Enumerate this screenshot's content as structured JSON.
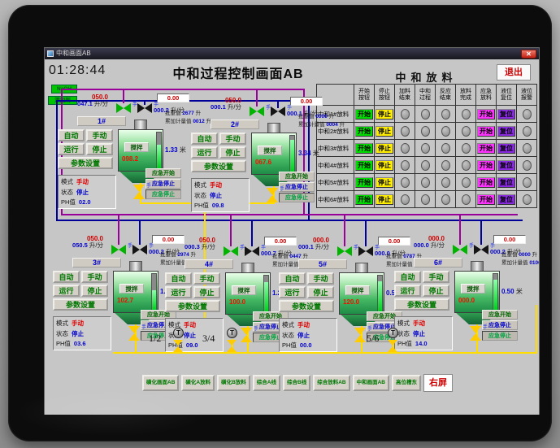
{
  "window": {
    "title": "中和画面AB",
    "close": "✕"
  },
  "header": {
    "time": "01:28:44",
    "title": "中和过程控制画面AB",
    "discharge_title": "中和放料",
    "exit_label": "退出"
  },
  "sources": {
    "line1": "NaOH",
    "line2": "添加剂"
  },
  "reactor_common": {
    "auto": "自动",
    "manual": "手动",
    "run": "运行",
    "stop": "停止",
    "params": "参数设置",
    "mode_label": "模式",
    "state_label": "状态",
    "ph_label": "PH值",
    "stir": "搅拌",
    "emergency_start": "应急开始",
    "emergency_stop": "应急停止",
    "emergency_stop2": "应急停止",
    "flow_unit": "升/分",
    "level_unit": "米",
    "vol_unit": "升",
    "batch_label": "批重值",
    "total_label": "累加计量值",
    "manual_flag": "手"
  },
  "reactors": [
    {
      "id": "1#",
      "flow_sp": "050.0",
      "flow_pv": "047.1",
      "flow2_sp": "0.00",
      "flow2_pv": "000.2",
      "batch": "2677",
      "total": "0012",
      "tank_value": "098.2",
      "level": "1.33",
      "mode": "手动",
      "state": "停止",
      "ph": "02.0",
      "level_pct": 65
    },
    {
      "id": "2#",
      "flow_sp": "050.0",
      "flow_pv": "000.1",
      "flow2_sp": "0.00",
      "flow2_pv": "000.1",
      "batch": "0000",
      "total": "0004",
      "tank_value": "067.6",
      "level": "3.34",
      "mode": "手动",
      "state": "停止",
      "ph": "09.8",
      "level_pct": 88
    },
    {
      "id": "3#",
      "flow_sp": "050.0",
      "flow_pv": "050.5",
      "flow2_sp": "0.00",
      "flow2_pv": "000.2",
      "batch": "2974",
      "total": "0010",
      "tank_value": "102.7",
      "level": "1.61",
      "mode": "手动",
      "state": "停止",
      "ph": "03.6",
      "level_pct": 55
    },
    {
      "id": "4#",
      "flow_sp": "050.0",
      "flow_pv": "000.3",
      "flow2_sp": "0.00",
      "flow2_pv": "000.7",
      "batch": "0447",
      "total": "0104",
      "tank_value": "100.0",
      "level": "1.29",
      "mode": "手动",
      "state": "停止",
      "ph": "09.0",
      "level_pct": 82
    },
    {
      "id": "5#",
      "flow_sp": "000.0",
      "flow_pv": "000.1",
      "flow2_sp": "0.00",
      "flow2_pv": "000.0",
      "batch": "0787",
      "total": "0001",
      "tank_value": "120.0",
      "level": "0.50",
      "mode": "手动",
      "state": "停止",
      "ph": "00.0",
      "level_pct": 85
    },
    {
      "id": "6#",
      "flow_sp": "000.0",
      "flow_pv": "000.0",
      "flow2_sp": "0.00",
      "flow2_pv": "000.2",
      "batch": "0000",
      "total": "0106",
      "tank_value": "000.0",
      "level": "0.50",
      "mode": "手动",
      "state": "停止",
      "ph": "14.0",
      "level_pct": 85
    }
  ],
  "pumps": [
    "1/2",
    "3/4",
    "5/6"
  ],
  "discharge_table": {
    "headers": [
      "开始\n按钮",
      "停止\n按钮",
      "加料\n结束",
      "中和\n过程",
      "反应\n结束",
      "放料\n完成",
      "应急\n放料",
      "液位\n复位",
      "液位\n报警"
    ],
    "rows": [
      "中和1#放料",
      "中和2#放料",
      "中和3#放料",
      "中和4#放料",
      "中和5#放料",
      "中和6#放料"
    ],
    "start_label": "开始",
    "stop_label": "停止",
    "emergency_label": "开始",
    "reset_label": "复位"
  },
  "bottom_buttons": [
    "磺化画面AB",
    "磺化A放料",
    "磺化B放料",
    "综合A线",
    "综合B线",
    "综合放料AB",
    "中和画面AB",
    "高位槽东",
    "右屏"
  ],
  "colors": {
    "start_green": "#00dd00",
    "stop_yellow": "#ffee00",
    "emergency_magenta": "#ff33ff",
    "reset_purple": "#8a2be2",
    "pipe_purple": "#990099",
    "pipe_blue": "#000099",
    "pipe_yellow": "#ffdd00",
    "setpoint_red": "#cc0000",
    "value_blue": "#0000cc",
    "exit_red": "#cc0000",
    "button_green": "#007700"
  }
}
